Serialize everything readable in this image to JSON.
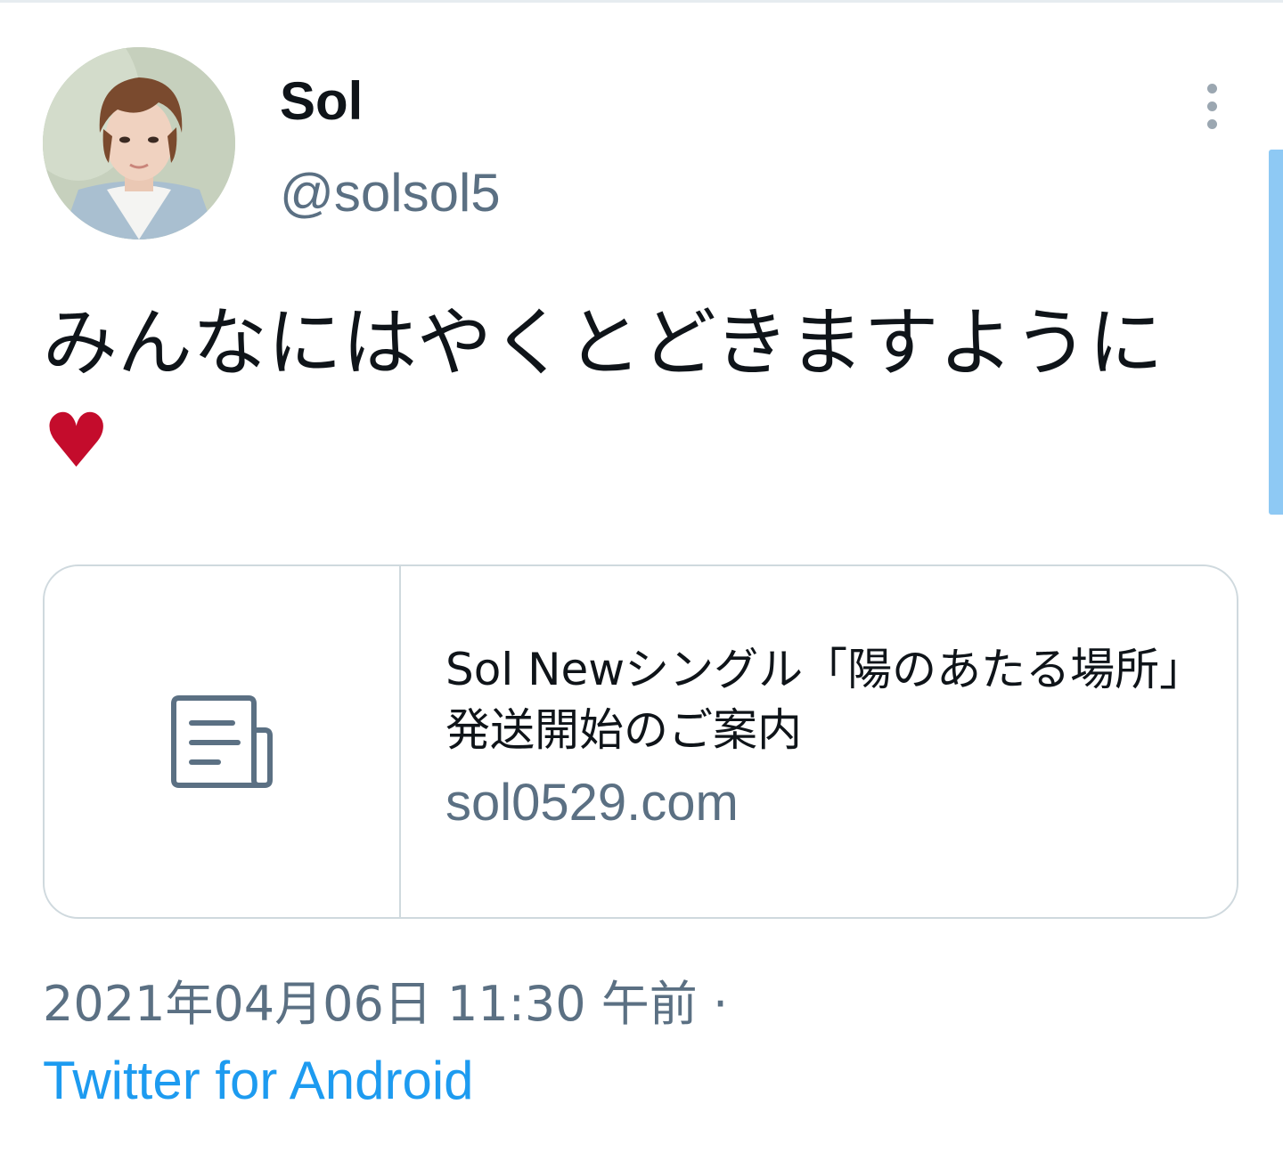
{
  "user": {
    "display_name": "Sol",
    "handle": "@solsol5"
  },
  "header": {
    "more_icon": "more-vertical-icon"
  },
  "tweet": {
    "text": "みんなにはやくとどきますように",
    "emoji": "♥",
    "emoji_color": "#c40c2c"
  },
  "link_card": {
    "thumbnail_icon": "article-icon",
    "title": "Sol Newシングル「陽のあたる場所」発送開始のご案内",
    "domain": "sol0529.com"
  },
  "meta": {
    "timestamp": "2021年04月06日 11:30 午前 ·",
    "source": "Twitter for Android"
  },
  "colors": {
    "text_primary": "#0f1419",
    "text_secondary": "#5b7083",
    "link": "#1d9bf0",
    "border": "#cfd9de",
    "scroll_indicator": "#8ec9f4"
  }
}
